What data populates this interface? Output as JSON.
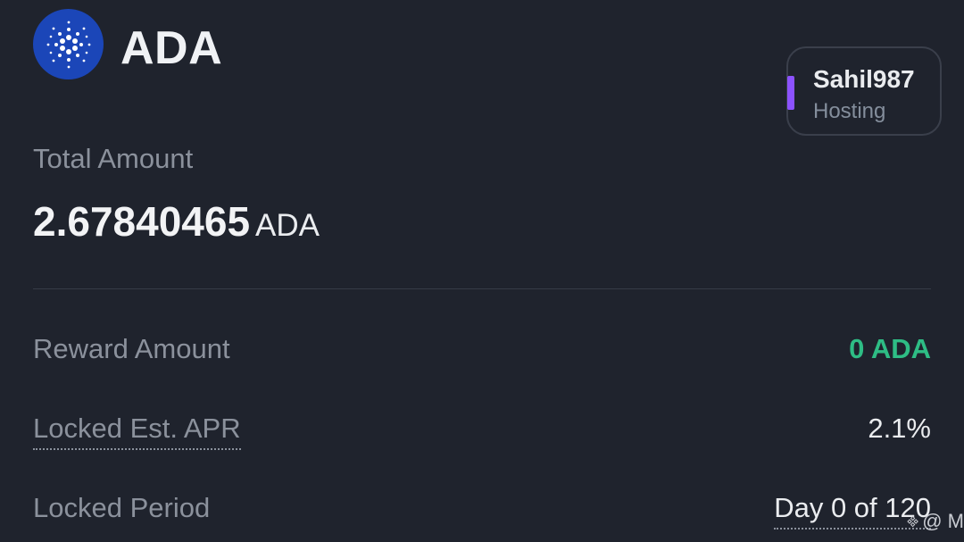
{
  "header": {
    "coin_icon": "cardano-logo-icon",
    "coin_symbol": "ADA",
    "host": {
      "name": "Sahil987",
      "role": "Hosting",
      "accent_color": "#8c52ff"
    }
  },
  "total": {
    "label": "Total Amount",
    "value": "2.67840465",
    "unit": "ADA"
  },
  "rows": [
    {
      "label": "Reward Amount",
      "value": "0 ADA",
      "value_color": "#2ebd85"
    },
    {
      "label": "Locked Est. APR",
      "value": "2.1%"
    },
    {
      "label": "Locked Period",
      "value": "Day 0 of 120"
    }
  ],
  "watermark": {
    "icon": "binance-logo-icon",
    "text": "@ M"
  }
}
